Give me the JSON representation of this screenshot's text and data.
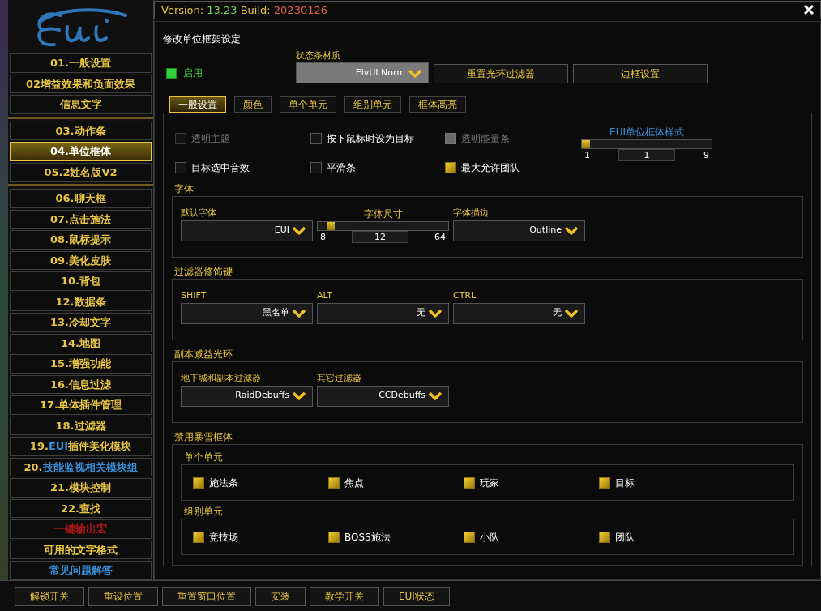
{
  "sidebar": {
    "groups": [
      [
        {
          "parts": [
            {
              "text": "01.一般设置",
              "kind": "plain"
            }
          ],
          "selected": false
        },
        {
          "parts": [
            {
              "text": "02增益效果和负面效果",
              "kind": "plain"
            }
          ],
          "selected": false
        },
        {
          "parts": [
            {
              "text": "信息文字",
              "kind": "plain"
            }
          ],
          "selected": false
        }
      ],
      [
        {
          "parts": [
            {
              "text": "03.动作条",
              "kind": "plain"
            }
          ],
          "selected": false
        },
        {
          "parts": [
            {
              "text": "04.单位框体",
              "kind": "plain"
            }
          ],
          "selected": true
        },
        {
          "parts": [
            {
              "text": "05.2姓名版V2",
              "kind": "plain"
            }
          ],
          "selected": false
        }
      ],
      [
        {
          "parts": [
            {
              "text": "06.聊天框",
              "kind": "plain"
            }
          ],
          "selected": false
        },
        {
          "parts": [
            {
              "text": "07.点击施法",
              "kind": "plain"
            }
          ],
          "selected": false
        },
        {
          "parts": [
            {
              "text": "08.鼠标提示",
              "kind": "plain"
            }
          ],
          "selected": false
        },
        {
          "parts": [
            {
              "text": "09.美化皮肤",
              "kind": "plain"
            }
          ],
          "selected": false
        },
        {
          "parts": [
            {
              "text": "10.背包",
              "kind": "plain"
            }
          ],
          "selected": false
        },
        {
          "parts": [
            {
              "text": "12.数据条",
              "kind": "plain"
            }
          ],
          "selected": false
        },
        {
          "parts": [
            {
              "text": "13.冷却文字",
              "kind": "plain"
            }
          ],
          "selected": false
        },
        {
          "parts": [
            {
              "text": "14.地图",
              "kind": "plain"
            }
          ],
          "selected": false
        },
        {
          "parts": [
            {
              "text": "15.增强功能",
              "kind": "plain"
            }
          ],
          "selected": false
        },
        {
          "parts": [
            {
              "text": "16.信息过滤",
              "kind": "plain"
            }
          ],
          "selected": false
        },
        {
          "parts": [
            {
              "text": "17.单体插件管理",
              "kind": "plain"
            }
          ],
          "selected": false
        },
        {
          "parts": [
            {
              "text": "18.过滤器",
              "kind": "plain"
            }
          ],
          "selected": false
        },
        {
          "parts": [
            {
              "text": "19.",
              "kind": "plain"
            },
            {
              "text": "EUI",
              "kind": "accent"
            },
            {
              "text": "插件美化模块",
              "kind": "plain"
            }
          ],
          "selected": false
        },
        {
          "parts": [
            {
              "text": "20.",
              "kind": "plain"
            },
            {
              "text": "技能监视相关模块组",
              "kind": "accent"
            }
          ],
          "selected": false
        },
        {
          "parts": [
            {
              "text": "21.模块控制",
              "kind": "plain"
            }
          ],
          "selected": false
        },
        {
          "parts": [
            {
              "text": "22.查找",
              "kind": "plain"
            }
          ],
          "selected": false
        },
        {
          "parts": [
            {
              "text": "一键输出宏",
              "kind": "alert"
            }
          ],
          "selected": false
        },
        {
          "parts": [
            {
              "text": "可用的文字格式",
              "kind": "plain"
            }
          ],
          "selected": false
        },
        {
          "parts": [
            {
              "text": "常见问题解答",
              "kind": "accent"
            }
          ],
          "selected": false
        }
      ]
    ]
  },
  "header": {
    "version_label": "Version: ",
    "version": "13.23",
    "build_label": " Build: ",
    "build": "20230126"
  },
  "page_title": "修改单位框架设定",
  "enable": {
    "label": "启用",
    "checked": true
  },
  "texture": {
    "label": "状态条材质",
    "value": "ElvUI Norm"
  },
  "top_buttons": [
    "重置光环过滤器",
    "边框设置"
  ],
  "tabs": [
    {
      "label": "一般设置",
      "selected": true
    },
    {
      "label": "颜色",
      "selected": false
    },
    {
      "label": "单个单元",
      "selected": false
    },
    {
      "label": "组别单元",
      "selected": false
    },
    {
      "label": "框体高亮",
      "selected": false
    }
  ],
  "options": [
    [
      {
        "label": "透明主题",
        "checked": false,
        "disabled": true
      },
      {
        "label": "按下鼠标时设为目标",
        "checked": false,
        "disabled": false
      },
      {
        "label": "透明能量条",
        "checked": true,
        "disabled": true
      }
    ],
    [
      {
        "label": "目标选中音效",
        "checked": false,
        "disabled": false
      },
      {
        "label": "平滑条",
        "checked": false,
        "disabled": false
      },
      {
        "label": "最大允许团队",
        "checked": true,
        "disabled": false
      }
    ]
  ],
  "style_slider": {
    "label": "EUI单位框体样式",
    "min": "1",
    "value": "1",
    "max": "9",
    "level": 0
  },
  "groups": [
    {
      "title": "字体",
      "controls": [
        {
          "kind": "dropdown",
          "label": "默认字体",
          "value": "EUI"
        },
        {
          "kind": "slider",
          "label": "字体尺寸",
          "min": "8",
          "value": "12",
          "max": "64",
          "level": 0.07
        },
        {
          "kind": "dropdown",
          "label": "字体描边",
          "value": "Outline"
        }
      ]
    },
    {
      "title": "过滤器修饰键",
      "controls": [
        {
          "kind": "dropdown",
          "label": "SHIFT",
          "value": "黑名单"
        },
        {
          "kind": "dropdown",
          "label": "ALT",
          "value": "无"
        },
        {
          "kind": "dropdown",
          "label": "CTRL",
          "value": "无"
        }
      ]
    },
    {
      "title": "副本减益光环",
      "controls": [
        {
          "kind": "dropdown",
          "label": "地下城和副本过滤器",
          "value": "RaidDebuffs"
        },
        {
          "kind": "dropdown",
          "label": "其它过滤器",
          "value": "CCDebuffs"
        }
      ]
    }
  ],
  "blizzard": {
    "title": "禁用暴雪框体",
    "subgroups": [
      {
        "title": "单个单元",
        "items": [
          {
            "label": "施法条",
            "checked": true
          },
          {
            "label": "焦点",
            "checked": true
          },
          {
            "label": "玩家",
            "checked": true
          },
          {
            "label": "目标",
            "checked": true
          }
        ]
      },
      {
        "title": "组别单元",
        "items": [
          {
            "label": "竞技场",
            "checked": true
          },
          {
            "label": "BOSS施法",
            "checked": true
          },
          {
            "label": "小队",
            "checked": true
          },
          {
            "label": "团队",
            "checked": true
          }
        ]
      }
    ]
  },
  "bottom_buttons": [
    "解锁开关",
    "重设位置",
    "重置窗口位置",
    "安装",
    "教学开关",
    "EUI状态"
  ]
}
